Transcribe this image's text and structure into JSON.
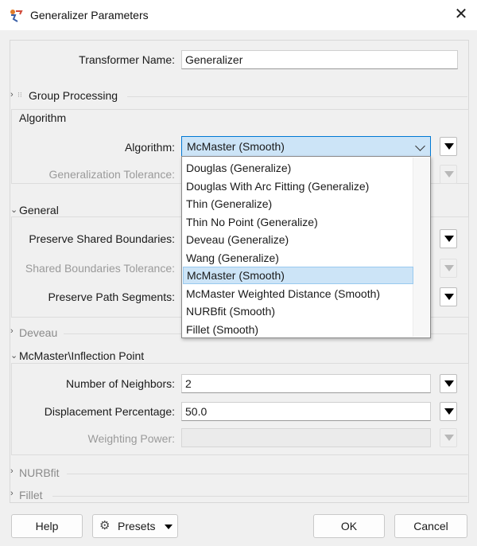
{
  "window": {
    "title": "Generalizer Parameters",
    "close_glyph": "✕"
  },
  "transformer_name": {
    "label": "Transformer Name:",
    "value": "Generalizer"
  },
  "group_processing": {
    "title": "Group Processing"
  },
  "algorithm_section": {
    "title": "Algorithm",
    "algorithm_label": "Algorithm:",
    "algorithm_value": "McMaster (Smooth)",
    "tolerance_label": "Generalization Tolerance:"
  },
  "general_section": {
    "title": "General",
    "preserve_shared_boundaries_label": "Preserve Shared Boundaries:",
    "shared_boundaries_tolerance_label": "Shared Boundaries Tolerance:",
    "preserve_path_segments_label": "Preserve Path Segments:"
  },
  "deveau_section": {
    "title": "Deveau"
  },
  "mcmaster_section": {
    "title": "McMaster\\Inflection Point",
    "neighbors_label": "Number of Neighbors:",
    "neighbors_value": "2",
    "displacement_label": "Displacement Percentage:",
    "displacement_value": "50.0",
    "weighting_label": "Weighting Power:"
  },
  "nurbfit_section": {
    "title": "NURBfit"
  },
  "fillet_section": {
    "title": "Fillet"
  },
  "dropdown": {
    "options": [
      "Douglas (Generalize)",
      "Douglas With Arc Fitting (Generalize)",
      "Thin (Generalize)",
      "Thin No Point (Generalize)",
      "Deveau (Generalize)",
      "Wang (Generalize)",
      "McMaster (Smooth)",
      "McMaster Weighted Distance (Smooth)",
      "NURBfit (Smooth)",
      "Fillet (Smooth)"
    ],
    "selected": "McMaster (Smooth)"
  },
  "buttons": {
    "help": "Help",
    "presets": "Presets",
    "ok": "OK",
    "cancel": "Cancel"
  },
  "colors": {
    "selection": "#cce4f7",
    "focus_border": "#0078d4",
    "window_bg": "#f0f0f0"
  }
}
